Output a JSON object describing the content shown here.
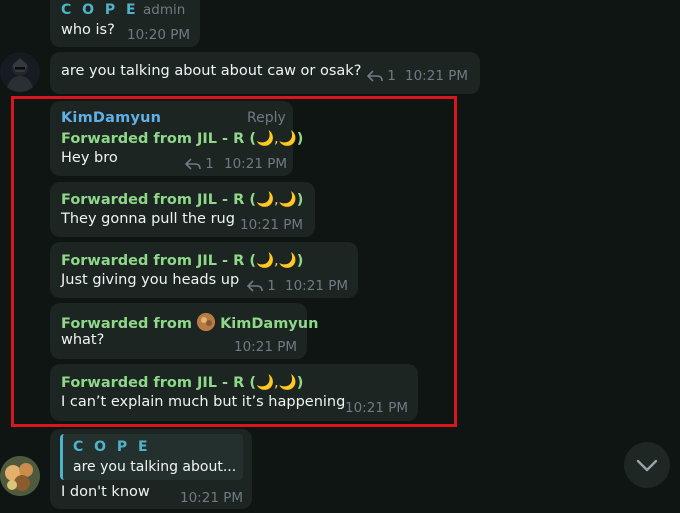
{
  "messages": {
    "m1": {
      "sender": "C O P E",
      "role": "admin",
      "text": "who is?",
      "time": "10:20 PM"
    },
    "m2": {
      "text": "are you talking about  about caw or osak?",
      "replies": "1",
      "time": "10:21 PM"
    },
    "m3": {
      "sender": "KimDamyun",
      "action": "Reply",
      "forwarded_prefix": "Forwarded from JIL - R (",
      "forwarded_suffix": ")",
      "moons": "🌙,🌙",
      "text": "Hey bro",
      "replies": "1",
      "time": "10:21 PM"
    },
    "m4": {
      "forwarded_prefix": "Forwarded from JIL - R (",
      "forwarded_suffix": ")",
      "moons": "🌙,🌙",
      "text": "They gonna pull the rug",
      "time": "10:21 PM"
    },
    "m5": {
      "forwarded_prefix": "Forwarded from JIL - R (",
      "forwarded_suffix": ")",
      "moons": "🌙,🌙",
      "text": "Just giving you heads up",
      "replies": "1",
      "time": "10:21 PM"
    },
    "m6": {
      "forwarded_prefix": "Forwarded from",
      "forwarded_name": "KimDamyun",
      "text": "what?",
      "time": "10:21 PM"
    },
    "m7": {
      "forwarded_prefix": "Forwarded from JIL - R (",
      "forwarded_suffix": ")",
      "moons": "🌙,🌙",
      "text": "I can’t explain much but it’s happening",
      "time": "10:21 PM"
    },
    "m8": {
      "quote_sender": "C O P E",
      "quote_text": "are you talking about...",
      "text": "I don't know",
      "time": "10:21 PM"
    }
  },
  "colors": {
    "background": "#0e1512",
    "bubble": "#1d2522",
    "forwarded": "#8fd88a",
    "admin_name": "#4fb3c9",
    "user_name": "#5fb0e6",
    "highlight": "#d8161e"
  },
  "icons": {
    "reply": "reply-arrow-icon",
    "scroll": "chevron-down-icon"
  }
}
